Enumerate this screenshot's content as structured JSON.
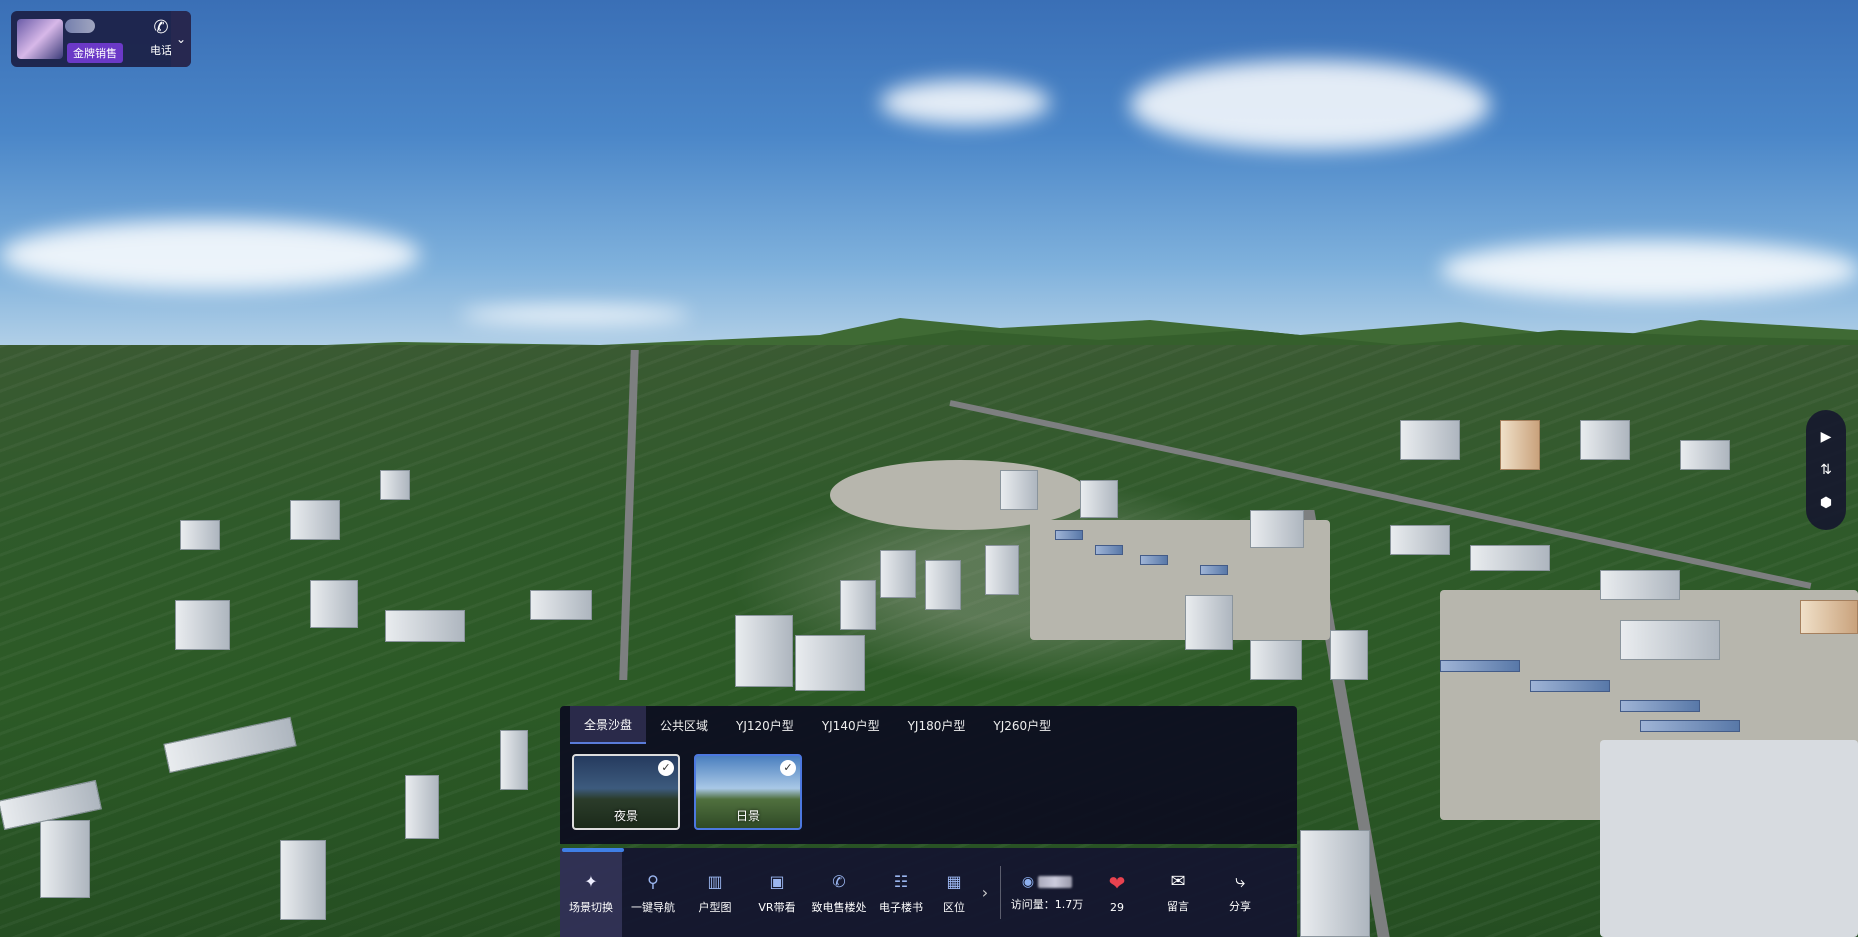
{
  "agent": {
    "badge": "金牌销售",
    "phone_label": "电话",
    "phone_icon": "phone-icon",
    "expand_icon": "chevron-down-icon"
  },
  "side_toolbar": {
    "icons": [
      "play-icon",
      "route-icon",
      "settings-icon"
    ]
  },
  "scene_panel": {
    "tabs": [
      {
        "label": "全景沙盘",
        "active": true
      },
      {
        "label": "公共区域",
        "active": false
      },
      {
        "label": "YJ120户型",
        "active": false
      },
      {
        "label": "YJ140户型",
        "active": false
      },
      {
        "label": "YJ180户型",
        "active": false
      },
      {
        "label": "YJ260户型",
        "active": false
      }
    ],
    "scenes": [
      {
        "label": "夜景",
        "checked": true
      },
      {
        "label": "日景",
        "checked": true,
        "selected": true
      }
    ]
  },
  "bottom_bar": {
    "items": [
      {
        "label": "场景切换",
        "icon": "grid-icon",
        "active": true
      },
      {
        "label": "一键导航",
        "icon": "location-pin-icon"
      },
      {
        "label": "户型图",
        "icon": "floorplan-icon"
      },
      {
        "label": "VR带看",
        "icon": "video-icon"
      },
      {
        "label": "致电售楼处",
        "icon": "phone-icon"
      },
      {
        "label": "电子楼书",
        "icon": "book-icon"
      },
      {
        "label": "区位",
        "icon": "building-icon"
      }
    ],
    "more_icon": "chevron-right-icon",
    "views_label": "访问量：1.7万",
    "likes_count": "29",
    "message_label": "留言",
    "share_label": "分享"
  }
}
